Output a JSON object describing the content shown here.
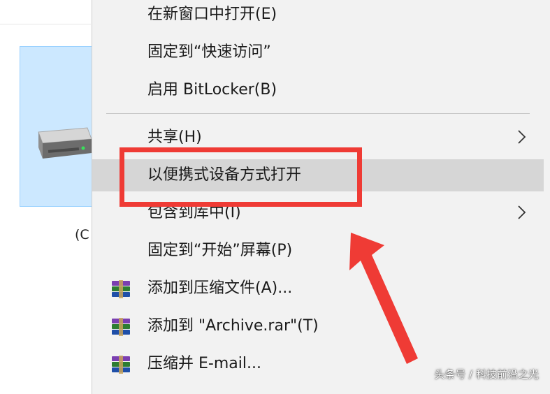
{
  "explorer": {
    "drive_label": "(C"
  },
  "context_menu": {
    "items": [
      {
        "label": "在新窗口中打开(E)"
      },
      {
        "label": "固定到“快速访问”"
      },
      {
        "label": "启用 BitLocker(B)"
      },
      {
        "label": "共享(H)"
      },
      {
        "label": "以便携式设备方式打开"
      },
      {
        "label": "包含到库中(I)"
      },
      {
        "label": "固定到“开始”屏幕(P)"
      },
      {
        "label": "添加到压缩文件(A)..."
      },
      {
        "label": "添加到 \"Archive.rar\"(T)"
      },
      {
        "label": "压缩并 E-mail..."
      }
    ]
  },
  "annotation": {
    "highlight_color": "#ef3b35"
  },
  "watermark": {
    "text": "头条号 / 科技前沿之光"
  }
}
